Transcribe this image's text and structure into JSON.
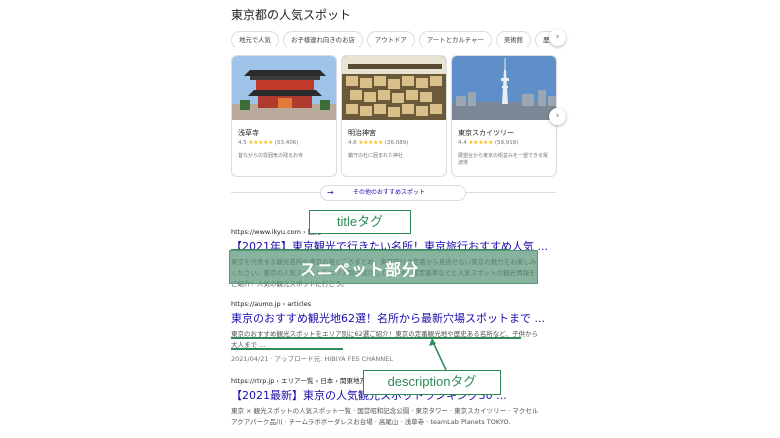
{
  "section_title": "東京都の人気スポット",
  "chips": [
    "地元で人気",
    "お子様連れ向きのお店",
    "アウトドア",
    "アートとカルチャー",
    "美術館",
    "歴史"
  ],
  "cards": [
    {
      "name": "浅草寺",
      "rating": "4.5",
      "stars": "★★★★★",
      "count": "(53,406)",
      "desc": "昔ながらの雰囲気の残るお寺"
    },
    {
      "name": "明治神宮",
      "rating": "4.6",
      "stars": "★★★★★",
      "count": "(26,089)",
      "desc": "鎮守の杜に囲まれた神社"
    },
    {
      "name": "東京スカイツリー",
      "rating": "4.4",
      "stars": "★★★★★",
      "count": "(59,918)",
      "desc": "展望台から東京の街並みを一望できる電波塔"
    }
  ],
  "more_button": "その他のおすすめスポット",
  "results": [
    {
      "cite": "https://www.ikyu.com › 観光",
      "title": "【2021年】東京観光で行きたい名所！東京旅行おすすめ人気 ...",
      "snippet": "東京を代表する観光名所や東京の見どころまとめ。東京旅行の定番から見逃せない東京の魅力をお楽しみください。東京の人気スポットをエリア別に紹介しています。選定基準などと人気スポットの観光情報をご紹介！人気の観光スポットに行こう。"
    },
    {
      "cite": "https://aumo.jp › articles",
      "title": "東京のおすすめ観光地62選！名所から最新穴場スポットまで ...",
      "snippet": "東京のおすすめ観光スポットをエリア別に62選ご紹介！東京の定番観光地や歴史ある名所など、子供から大人まで ...",
      "date": "2021/04/21 · アップロード元: HIBIYA FES CHANNEL"
    },
    {
      "cite": "https://rtrp.jp › エリア一覧 › 日本 › 関東地方 › 東京",
      "title": "【2021最新】東京の人気観光スポットランキング30 ...",
      "snippet": "東京 × 観光スポットの人気スポット一覧 · 国営昭和記念公園 · 東京タワー · 東京スカイツリー · マクセル アクアパーク品川 · チームラボボーダレスお台場 · 高尾山 · 浅草寺 · teamLab Planets TOKYO."
    }
  ],
  "callouts": {
    "title_tag": "titleタグ",
    "snippet_part": "スニペット部分",
    "description_tag": "descriptionタグ"
  },
  "colors": {
    "link": "#1a0dab",
    "annotation": "#2e8b57",
    "star": "#fbbc04"
  }
}
